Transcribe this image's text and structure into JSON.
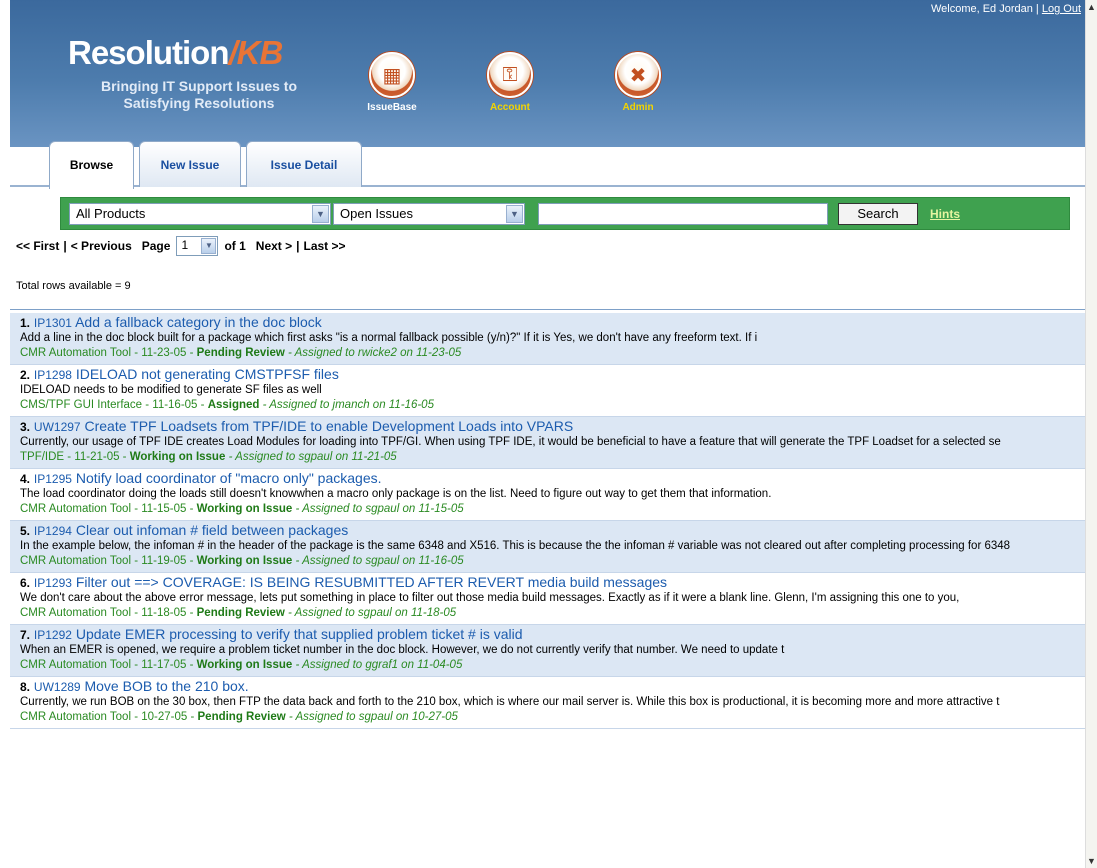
{
  "header": {
    "welcome_text": "Welcome, Ed Jordan |",
    "logout_label": "Log Out",
    "logo_main": "Resolution",
    "logo_accent": "/KB",
    "tagline": "Bringing IT Support Issues to Satisfying Resolutions",
    "nav": [
      {
        "label": "IssueBase",
        "icon": "issuebase-icon"
      },
      {
        "label": "Account",
        "icon": "account-icon"
      },
      {
        "label": "Admin",
        "icon": "admin-icon"
      }
    ]
  },
  "tabs": [
    {
      "label": "Browse",
      "active": true
    },
    {
      "label": "New Issue",
      "active": false
    },
    {
      "label": "Issue Detail",
      "active": false
    }
  ],
  "search": {
    "product_value": "All Products",
    "status_value": "Open Issues",
    "query_value": "",
    "search_label": "Search",
    "hints_label": "Hints"
  },
  "pager": {
    "first": "<< First",
    "sep1": "|",
    "previous": "< Previous",
    "page_label": "Page",
    "page_value": "1",
    "of_label": "of 1",
    "next": "Next >",
    "sep2": "|",
    "last": "Last >>"
  },
  "totals": "Total rows available = 9",
  "colors": {
    "header_blue": "#4d7cad",
    "search_green": "#3fa14f",
    "link_blue": "#1c5cae",
    "meta_green": "#2a8a22",
    "alt_row": "#dce7f4"
  },
  "issues": [
    {
      "num": "1.",
      "id": "IP1301",
      "summary": "Add a fallback category in the doc block",
      "desc": "Add a line in the doc block built for a package which first asks \"is a normal fallback possible (y/n)?\" If it is Yes, we don't have any freeform text. If i",
      "meta": "CMR Automation Tool - 11-23-05 -",
      "status": "Pending Review",
      "assigned": "- Assigned to rwicke2 on 11-23-05"
    },
    {
      "num": "2.",
      "id": "IP1298",
      "summary": "IDELOAD not generating CMSTPFSF files",
      "desc": "IDELOAD needs to be modified to generate SF files as well",
      "meta": "CMS/TPF GUI Interface - 11-16-05 -",
      "status": "Assigned",
      "assigned": "- Assigned to jmanch on 11-16-05"
    },
    {
      "num": "3.",
      "id": "UW1297",
      "summary": "Create TPF Loadsets from TPF/IDE to enable Development Loads into VPARS",
      "desc": "Currently, our usage of TPF IDE creates Load Modules for loading into TPF/GI.  When using TPF IDE, it would be beneficial to have a feature that will generate the TPF Loadset for a selected se",
      "meta": "TPF/IDE - 11-21-05 -",
      "status": "Working on Issue",
      "assigned": "- Assigned to sgpaul on 11-21-05"
    },
    {
      "num": "4.",
      "id": "IP1295",
      "summary": "Notify load coordinator of \"macro only\" packages.",
      "desc": "The load coordinator doing the loads still doesn't knowwhen a macro only package is on the list.  Need to figure out way to get them that information.",
      "meta": "CMR Automation Tool - 11-15-05 -",
      "status": "Working on Issue",
      "assigned": "- Assigned to sgpaul on 11-15-05"
    },
    {
      "num": "5.",
      "id": "IP1294",
      "summary": "Clear out infoman # field between packages",
      "desc": "In the example below, the infoman # in the header of the package is the same 6348 and X516.  This is because the the infoman # variable was not cleared out after completing processing for 6348",
      "meta": "CMR Automation Tool - 11-19-05 -",
      "status": "Working on Issue",
      "assigned": "- Assigned to sgpaul on 11-16-05"
    },
    {
      "num": "6.",
      "id": "IP1293",
      "summary": "Filter out ==> COVERAGE: IS BEING RESUBMITTED AFTER REVERT media build messages",
      "desc": "We don't care about the above error message, lets put something in place to filter out those media build messages.  Exactly as if it were a blank line. Glenn, I'm assigning this one to you,",
      "meta": "CMR Automation Tool - 11-18-05 -",
      "status": "Pending Review",
      "assigned": "- Assigned to sgpaul on 11-18-05"
    },
    {
      "num": "7.",
      "id": "IP1292",
      "summary": "Update EMER processing to verify that supplied problem ticket # is valid",
      "desc": "When an EMER is opened, we require a problem ticket number in the doc block.  However, we do not currently verify that number.  We need to update t",
      "meta": "CMR Automation Tool - 11-17-05 -",
      "status": "Working on Issue",
      "assigned": "- Assigned to ggraf1 on 11-04-05"
    },
    {
      "num": "8.",
      "id": "UW1289",
      "summary": "Move BOB to the 210 box.",
      "desc": "Currently, we run BOB on the 30 box, then FTP the data back and forth to the 210 box, which is where our mail server is.  While this box is productional, it is becoming more and more attractive t",
      "meta": "CMR Automation Tool - 10-27-05 -",
      "status": "Pending Review",
      "assigned": "- Assigned to sgpaul on 10-27-05"
    }
  ]
}
